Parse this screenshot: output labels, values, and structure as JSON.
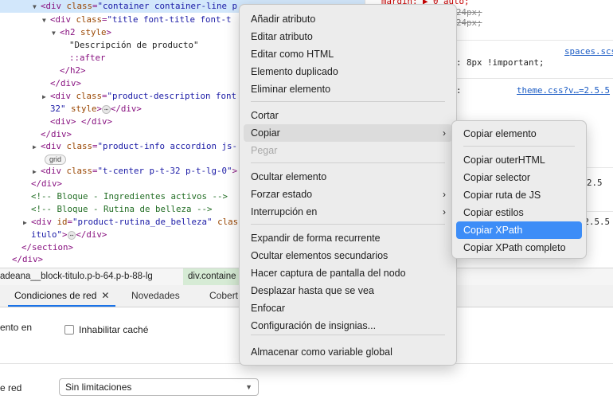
{
  "elements_tree": {
    "lines": [
      {
        "tri": "▼",
        "segs": [
          [
            "tag",
            "<div "
          ],
          [
            "attr",
            "class"
          ],
          [
            "tag",
            "="
          ],
          [
            "val",
            "\"container container-line p"
          ]
        ]
      },
      {
        "tri": "▼",
        "segs": [
          [
            "tag",
            "<div "
          ],
          [
            "attr",
            "class"
          ],
          [
            "tag",
            "="
          ],
          [
            "val",
            "\"title font-title font-t"
          ]
        ]
      },
      {
        "tri": "▼",
        "segs": [
          [
            "tag",
            "<h2 "
          ],
          [
            "attr",
            "style"
          ],
          [
            "tag",
            ">"
          ]
        ]
      },
      {
        "tri": "",
        "segs": [
          [
            "plain",
            "\"Descripción de producto\""
          ]
        ]
      },
      {
        "tri": "",
        "segs": [
          [
            "tag",
            "::after"
          ]
        ]
      },
      {
        "tri": "",
        "segs": [
          [
            "tag",
            "</h2>"
          ]
        ]
      },
      {
        "tri": "",
        "segs": [
          [
            "tag",
            "</div>"
          ]
        ]
      },
      {
        "tri": "▶",
        "segs": [
          [
            "tag",
            "<div "
          ],
          [
            "attr",
            "class"
          ],
          [
            "tag",
            "="
          ],
          [
            "val",
            "\"product-description font"
          ]
        ]
      },
      {
        "tri": "",
        "segs": [
          [
            "val",
            "32\" "
          ],
          [
            "attr",
            "style"
          ],
          [
            "tag",
            ">"
          ],
          [
            "ell",
            "⋯"
          ],
          [
            "tag",
            "</div>"
          ]
        ]
      },
      {
        "tri": "",
        "segs": [
          [
            "tag",
            "<div> </div>"
          ]
        ]
      },
      {
        "tri": "",
        "segs": [
          [
            "tag",
            "</div>"
          ]
        ]
      },
      {
        "tri": "▶",
        "segs": [
          [
            "tag",
            "<div "
          ],
          [
            "attr",
            "class"
          ],
          [
            "tag",
            "="
          ],
          [
            "val",
            "\"product-info accordion js-"
          ]
        ]
      },
      {
        "tri": "",
        "segs": []
      },
      {
        "tri": "▶",
        "segs": [
          [
            "tag",
            "<div "
          ],
          [
            "attr",
            "class"
          ],
          [
            "tag",
            "="
          ],
          [
            "val",
            "\"t-center p-t-32 p-t-lg-0\""
          ],
          [
            "tag",
            ">"
          ]
        ]
      },
      {
        "tri": "",
        "segs": [
          [
            "tag",
            "</div>"
          ]
        ]
      },
      {
        "tri": "",
        "segs": [
          [
            "cmt",
            "<!-- Bloque - Ingredientes activos -->"
          ]
        ]
      },
      {
        "tri": "",
        "segs": [
          [
            "cmt",
            "<!-- Bloque - Rutina de belleza -->"
          ]
        ]
      },
      {
        "tri": "▶",
        "segs": [
          [
            "tag",
            "<div "
          ],
          [
            "attr",
            "id"
          ],
          [
            "tag",
            "="
          ],
          [
            "val",
            "\"product-rutina_de_belleza\""
          ],
          [
            "attr",
            " clas"
          ]
        ]
      },
      {
        "tri": "",
        "segs": [
          [
            "val",
            "itulo\""
          ],
          [
            "tag",
            ">"
          ],
          [
            "ell",
            "⋯"
          ],
          [
            "tag",
            "</div>"
          ]
        ]
      },
      {
        "tri": "",
        "segs": [
          [
            "tag",
            "</section>"
          ]
        ]
      },
      {
        "tri": "",
        "segs": [
          [
            "tag",
            "</div>"
          ]
        ]
      }
    ],
    "grid_badge": "grid"
  },
  "styles_pane": {
    "rules": [
      {
        "text": "margin: ▶ 0 auto;",
        "cls": "prop"
      },
      {
        "text": "24px;",
        "cls": "strike"
      },
      {
        "text": "24px;",
        "cls": "strike"
      },
      {
        "text": "spaces.scs",
        "cls": "link"
      },
      {
        "text": ": 8px !important;",
        "cls": ""
      },
      {
        "text": "theme.css?v…=2.5.5",
        "cls": "link"
      },
      {
        "text": ":",
        "cls": ""
      },
      {
        "text": "2.5",
        "cls": ""
      },
      {
        "text": "=2.5.5",
        "cls": ""
      }
    ]
  },
  "breadcrumb": {
    "items": [
      "adeana__block-titulo.p-b-64.p-b-88-lg",
      "div.containe"
    ]
  },
  "drawer": {
    "tabs": [
      "Condiciones de red",
      "Novedades",
      "Cobert"
    ],
    "close_symbol": "✕"
  },
  "network_conditions": {
    "cache_label_partial": "ento en",
    "disable_cache_label": "Inhabilitar caché",
    "throttle_label_partial": "e red",
    "throttle_value": "Sin limitaciones"
  },
  "context_menu": {
    "items": [
      {
        "label": "Añadir atributo"
      },
      {
        "label": "Editar atributo"
      },
      {
        "label": "Editar como HTML"
      },
      {
        "label": "Elemento duplicado"
      },
      {
        "label": "Eliminar elemento"
      },
      {
        "label": "Cortar"
      },
      {
        "label": "Copiar",
        "submenu": true,
        "hover": true
      },
      {
        "label": "Pegar",
        "disabled": true
      },
      {
        "label": "Ocultar elemento"
      },
      {
        "label": "Forzar estado",
        "submenu": true
      },
      {
        "label": "Interrupción en",
        "submenu": true
      },
      {
        "label": "Expandir de forma recurrente"
      },
      {
        "label": "Ocultar elementos secundarios"
      },
      {
        "label": "Hacer captura de pantalla del nodo"
      },
      {
        "label": "Desplazar hasta que se vea"
      },
      {
        "label": "Enfocar"
      },
      {
        "label": "Configuración de insignias..."
      },
      {
        "label": "Almacenar como variable global"
      }
    ],
    "submenu_arrow": "›"
  },
  "copy_submenu": {
    "items": [
      {
        "label": "Copiar elemento"
      },
      {
        "label": "Copiar outerHTML"
      },
      {
        "label": "Copiar selector"
      },
      {
        "label": "Copiar ruta de JS"
      },
      {
        "label": "Copiar estilos"
      },
      {
        "label": "Copiar XPath",
        "highlight": true
      },
      {
        "label": "Copiar XPath completo"
      }
    ]
  },
  "colors": {
    "accent": "#3d8df7",
    "selection": "#d2e7fb",
    "tab_underline": "#1a73e8"
  }
}
